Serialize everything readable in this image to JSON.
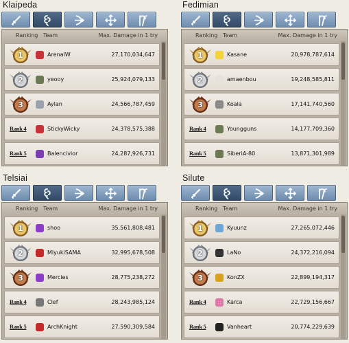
{
  "header": {
    "ranking": "Ranking",
    "team": "Team",
    "max_damage": "Max. Damage in 1 try"
  },
  "colors": {
    "tab_blue": "#7a97b8",
    "tab_active": "#3e5775",
    "gold": "#c9a24a",
    "silver": "#9aa0a6",
    "bronze": "#8a4a2a"
  },
  "quadrants": [
    {
      "title": "Klaipeda",
      "rows": [
        {
          "rank": "1",
          "team": "ArenaIW",
          "damage": "27,170,034,647",
          "icon": "red-hat-icon"
        },
        {
          "rank": "2",
          "team": "yeooy",
          "damage": "25,924,079,133",
          "icon": "avatar-icon"
        },
        {
          "rank": "3",
          "team": "Aylan",
          "damage": "24,566,787,459",
          "icon": "round-icon"
        },
        {
          "rank": "Rank 4",
          "team": "StickyWicky",
          "damage": "24,378,575,388",
          "icon": "red-hat-icon"
        },
        {
          "rank": "Rank 5",
          "team": "Balencivior",
          "damage": "24,287,926,731",
          "icon": "purple-emblem-icon"
        }
      ]
    },
    {
      "title": "Fedimian",
      "rows": [
        {
          "rank": "1",
          "team": "Kasane",
          "damage": "20,978,787,614",
          "icon": "chick-icon"
        },
        {
          "rank": "2",
          "team": "amaenbou",
          "damage": "19,248,585,811",
          "icon": "white-hat-icon"
        },
        {
          "rank": "3",
          "team": "Koala",
          "damage": "17,141,740,560",
          "icon": "koala-icon"
        },
        {
          "rank": "Rank 4",
          "team": "Youngguns",
          "damage": "14,177,709,360",
          "icon": "avatar-icon"
        },
        {
          "rank": "Rank 5",
          "team": "SiberiA-80",
          "damage": "13,871,301,989",
          "icon": "avatar-icon"
        }
      ]
    },
    {
      "title": "Telsiai",
      "rows": [
        {
          "rank": "1",
          "team": "shoo",
          "damage": "35,561,808,481",
          "icon": "purple-rabbit-icon"
        },
        {
          "rank": "2",
          "team": "MiyukiSAMA",
          "damage": "32,995,678,508",
          "icon": "red-wing-icon"
        },
        {
          "rank": "3",
          "team": "Mercies",
          "damage": "28,775,238,272",
          "icon": "purple-rabbit-icon"
        },
        {
          "rank": "Rank 4",
          "team": "Clef",
          "damage": "28,243,985,124",
          "icon": "clef-icon"
        },
        {
          "rank": "Rank 5",
          "team": "ArchKnight",
          "damage": "27,590,309,584",
          "icon": "red-wing-icon"
        }
      ]
    },
    {
      "title": "Silute",
      "rows": [
        {
          "rank": "1",
          "team": "Kyuunz",
          "damage": "27,265,072,446",
          "icon": "snowflake-icon"
        },
        {
          "rank": "2",
          "team": "LaNo",
          "damage": "24,372,216,094",
          "icon": "bird-icon"
        },
        {
          "rank": "3",
          "team": "KonZX",
          "damage": "22,899,194,317",
          "icon": "gold-coin-icon"
        },
        {
          "rank": "Rank 4",
          "team": "Karca",
          "damage": "22,729,156,667",
          "icon": "pink-sheep-icon"
        },
        {
          "rank": "Rank 5",
          "team": "Vanheart",
          "damage": "20,774,229,639",
          "icon": "black-hat-icon"
        }
      ]
    }
  ]
}
